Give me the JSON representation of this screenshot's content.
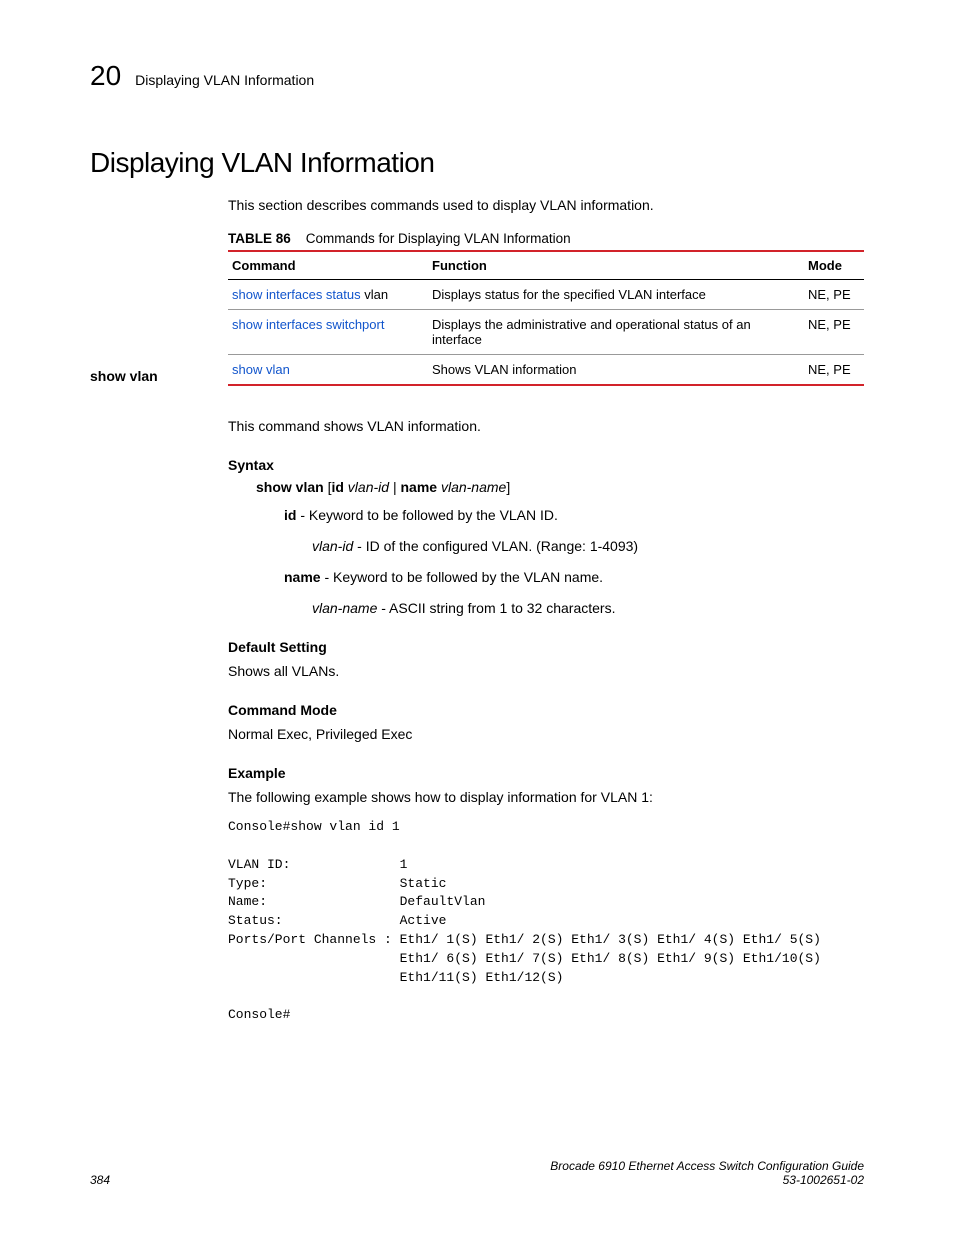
{
  "header": {
    "chapter_num": "20",
    "title": "Displaying VLAN Information"
  },
  "main_heading": "Displaying VLAN Information",
  "intro": "This section describes commands used to display VLAN information.",
  "table": {
    "label": "TABLE 86",
    "caption": "Commands for Displaying VLAN Information",
    "headers": {
      "command": "Command",
      "function": "Function",
      "mode": "Mode"
    },
    "rows": [
      {
        "cmd_link": "show interfaces status",
        "cmd_tail": " vlan",
        "func": "Displays status for the specified VLAN interface",
        "mode": "NE, PE"
      },
      {
        "cmd_link": "show interfaces switchport",
        "cmd_tail": "",
        "func": "Displays the administrative and operational status of an interface",
        "mode": "NE, PE"
      },
      {
        "cmd_link": "show vlan",
        "cmd_tail": "",
        "func": "Shows VLAN information",
        "mode": "NE, PE"
      }
    ]
  },
  "sidebar_label": "show vlan",
  "desc": "This command shows VLAN information.",
  "syntax": {
    "heading": "Syntax",
    "line_bold1": "show vlan",
    "line_plain1": " [",
    "line_bold2": "id",
    "line_var1": " vlan-id",
    "line_plain2": " | ",
    "line_bold3": "name",
    "line_var2": " vlan-name",
    "line_plain3": "]",
    "id_bold": "id",
    "id_text": " - Keyword to be followed by the VLAN ID.",
    "vlanid_var": "vlan-id",
    "vlanid_text": " - ID of the configured VLAN. (Range: 1-4093)",
    "name_bold": "name",
    "name_text": " - Keyword to be followed by the VLAN name.",
    "vlanname_var": "vlan-name",
    "vlanname_text": " - ASCII string from 1 to 32 characters."
  },
  "default": {
    "heading": "Default Setting",
    "text": "Shows all VLANs."
  },
  "cmdmode": {
    "heading": "Command Mode",
    "text": "Normal Exec, Privileged Exec"
  },
  "example": {
    "heading": "Example",
    "text": "The following example shows how to display information for VLAN 1:",
    "console": "Console#show vlan id 1\n\nVLAN ID:              1\nType:                 Static\nName:                 DefaultVlan\nStatus:               Active\nPorts/Port Channels : Eth1/ 1(S) Eth1/ 2(S) Eth1/ 3(S) Eth1/ 4(S) Eth1/ 5(S)\n                      Eth1/ 6(S) Eth1/ 7(S) Eth1/ 8(S) Eth1/ 9(S) Eth1/10(S)\n                      Eth1/11(S) Eth1/12(S)\n\nConsole#"
  },
  "footer": {
    "page": "384",
    "book": "Brocade 6910 Ethernet Access Switch Configuration Guide",
    "docnum": "53-1002651-02"
  }
}
